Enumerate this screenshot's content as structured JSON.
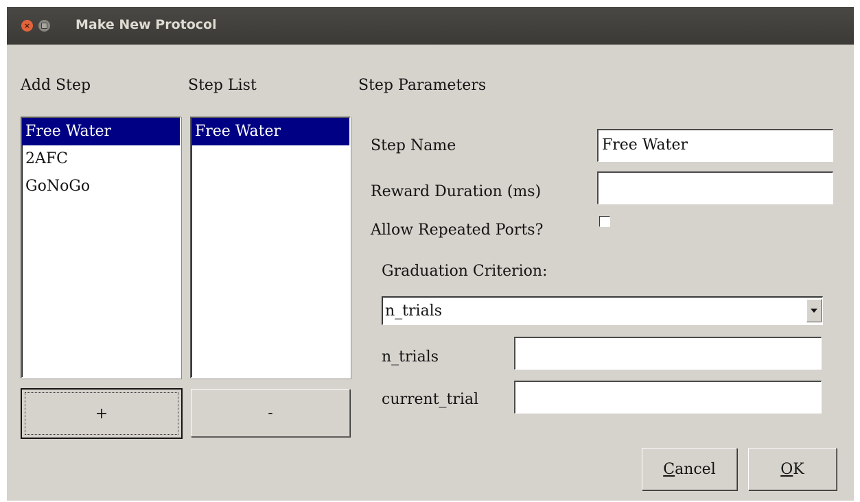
{
  "window": {
    "title": "Make New Protocol"
  },
  "add_step": {
    "heading": "Add Step",
    "items": [
      "Free Water",
      "2AFC",
      "GoNoGo"
    ],
    "selected": "Free Water",
    "add_button": "+"
  },
  "step_list": {
    "heading": "Step List",
    "items": [
      "Free Water"
    ],
    "selected": "Free Water",
    "remove_button": "-"
  },
  "params": {
    "heading": "Step Parameters",
    "step_name_label": "Step Name",
    "step_name_value": "Free Water",
    "reward_label": "Reward Duration (ms)",
    "reward_value": "",
    "repeat_label": "Allow Repeated Ports?",
    "repeat_checked": false,
    "graduation_label": "Graduation Criterion:",
    "graduation_value": "n_trials",
    "n_trials_label": "n_trials",
    "n_trials_value": "",
    "current_trial_label": "current_trial",
    "current_trial_value": ""
  },
  "buttons": {
    "cancel_mnemonic": "C",
    "cancel_rest": "ancel",
    "ok_mnemonic": "O",
    "ok_rest": "K"
  }
}
